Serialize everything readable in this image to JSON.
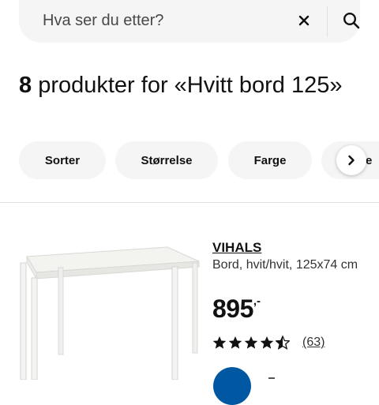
{
  "search": {
    "placeholder": "Hva ser du etter?",
    "clear_icon": "close-icon",
    "submit_icon": "search-icon"
  },
  "results": {
    "count": "8",
    "text": " produkter for «Hvitt bord 125»"
  },
  "filters": [
    {
      "label": "Sorter"
    },
    {
      "label": "Størrelse"
    },
    {
      "label": "Farge"
    },
    {
      "label": "Pe"
    }
  ],
  "filters_scroll_icon": "chevron-right-icon",
  "product": {
    "name": "VIHALS",
    "description": "Bord, hvit/hvit, 125x74 cm",
    "price": "895",
    "price_suffix": ",-",
    "rating_value": 4.5,
    "rating_max": 5,
    "rating_count": "(63)",
    "image_icon": "white-table-image",
    "cart_icon": "add-to-cart-icon"
  },
  "colors": {
    "accent": "#0058a3",
    "chip_bg": "#f5f5f5",
    "text": "#111111"
  }
}
